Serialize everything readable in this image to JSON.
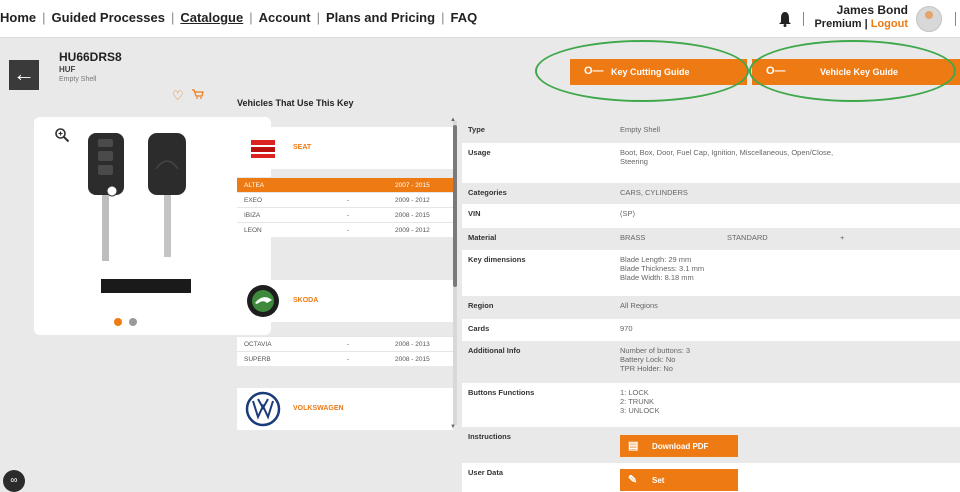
{
  "nav": {
    "items": [
      {
        "label": "Home"
      },
      {
        "label": "Guided Processes"
      },
      {
        "label": "Catalogue"
      },
      {
        "label": "Account"
      },
      {
        "label": "Plans and Pricing"
      },
      {
        "label": "FAQ"
      }
    ],
    "separator": "|"
  },
  "user": {
    "name": "James Bond",
    "plan": "Premium",
    "separator": "|",
    "logout": "Logout",
    "bell_icon": "bell-icon",
    "avatar_icon": "avatar"
  },
  "key": {
    "title": "HU66DRS8",
    "brand": "HUF",
    "kind": "Empty Shell",
    "favorite_icon": "heart-icon",
    "cart_icon": "cart-icon",
    "back_icon": "arrow-left-icon"
  },
  "guides": {
    "cutting_label": "Key Cutting Guide",
    "vehicle_label": "Vehicle Key Guide",
    "icon": "key-icon"
  },
  "image": {
    "zoom_icon": "magnifier-icon",
    "carousel_dots": 2,
    "active_dot": 1
  },
  "vehicles": {
    "heading": "Vehicles That Use This Key",
    "brands": [
      {
        "name": "SEAT",
        "logo_icon": "seat-logo",
        "models": [
          {
            "name": "ALTEA",
            "years": "2007 - 2015",
            "selected": true
          },
          {
            "name": "EXEO",
            "years": "2009 - 2012",
            "selected": false
          },
          {
            "name": "IBIZA",
            "years": "2008 - 2015",
            "selected": false
          },
          {
            "name": "LEON",
            "years": "2009 - 2012",
            "selected": false
          }
        ]
      },
      {
        "name": "SKODA",
        "logo_icon": "skoda-logo",
        "models": [
          {
            "name": "OCTAVIA",
            "years": "2008 - 2013",
            "selected": false
          },
          {
            "name": "SUPERB",
            "years": "2008 - 2015",
            "selected": false
          }
        ]
      },
      {
        "name": "VOLKSWAGEN",
        "logo_icon": "volkswagen-logo",
        "models": []
      }
    ],
    "dash": "-"
  },
  "details": {
    "type": {
      "label": "Type",
      "value": "Empty Shell"
    },
    "usage": {
      "label": "Usage",
      "value": "Boot, Box, Door, Fuel Cap, Ignition, Miscellaneous, Open/Close,\nSteering"
    },
    "categories": {
      "label": "Categories",
      "value": "CARS, CYLINDERS"
    },
    "vin": {
      "label": "VIN",
      "value": "(SP)"
    },
    "material": {
      "label": "Material",
      "value": "BRASS",
      "value2": "STANDARD",
      "value3": "+"
    },
    "key_dimensions": {
      "label": "Key dimensions",
      "value": "Blade Length: 29 mm\nBlade Thickness: 3.1 mm\nBlade Width: 8.18 mm"
    },
    "region": {
      "label": "Region",
      "value": "All Regions"
    },
    "cards": {
      "label": "Cards",
      "value": "970"
    },
    "additional_info": {
      "label": "Additional Info",
      "value": "Number of buttons: 3\nBattery Lock: No\nTPR Holder: No"
    },
    "buttons_functions": {
      "label": "Buttons Functions",
      "value": "1: LOCK\n2: TRUNK\n3: UNLOCK"
    },
    "instructions": {
      "label": "Instructions",
      "button_label": "Download PDF",
      "button_icon": "pdf-icon"
    },
    "user_data": {
      "label": "User Data",
      "button_label": "Set",
      "button_icon": "pencil-icon"
    }
  },
  "colors": {
    "accent": "#ee7a14",
    "annotation": "#3fa84a",
    "panel_bg": "#e9e9e9"
  }
}
